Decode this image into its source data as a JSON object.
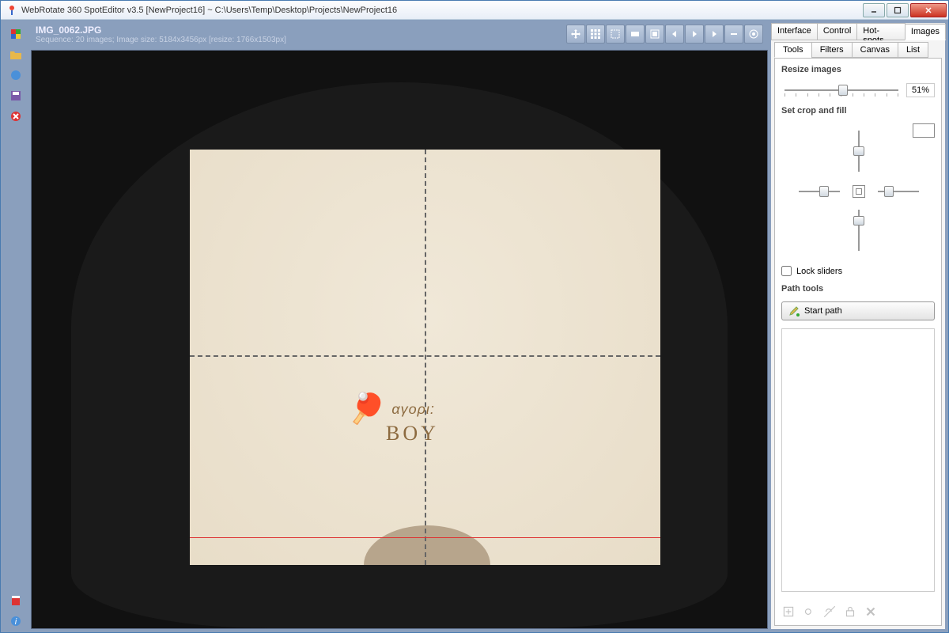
{
  "window": {
    "title": "WebRotate 360 SpotEditor v3.5 [NewProject16]  ~  C:\\Users\\Temp\\Desktop\\Projects\\NewProject16"
  },
  "image": {
    "filename": "IMG_0062.JPG",
    "meta": "Sequence: 20 images; Image size: 5184x3456px [resize: 1766x1503px]",
    "logo_greek": "αγορι:",
    "logo_en": "BOY"
  },
  "mainTabs": {
    "interface": "Interface",
    "control": "Control",
    "hotspots": "Hot-spots",
    "images": "Images"
  },
  "subTabs": {
    "tools": "Tools",
    "filters": "Filters",
    "canvas": "Canvas",
    "list": "List"
  },
  "tools": {
    "resize_label": "Resize images",
    "resize_pct": "51%",
    "crop_label": "Set crop and fill",
    "lock_label": "Lock sliders",
    "path_label": "Path tools",
    "start_path": "Start path"
  }
}
